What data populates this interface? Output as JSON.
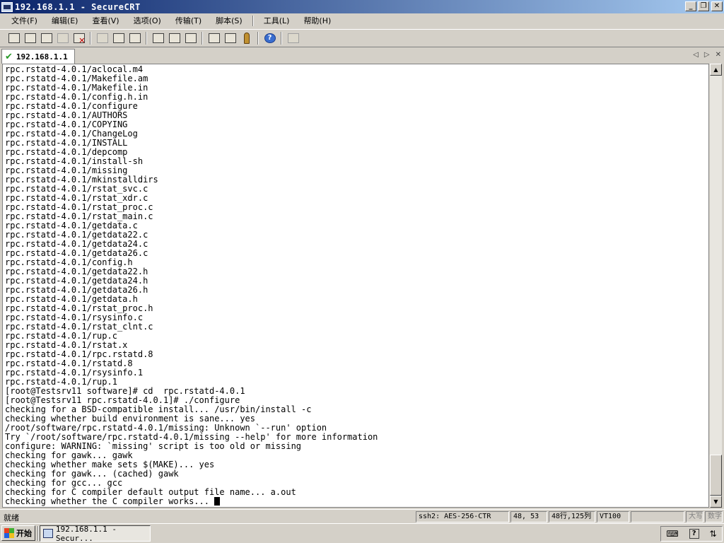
{
  "window": {
    "title": "192.168.1.1 - SecureCRT",
    "buttons": {
      "minimize": "_",
      "maximize": "❐",
      "close": "✕"
    }
  },
  "menu": [
    "文件(F)",
    "编辑(E)",
    "查看(V)",
    "选项(O)",
    "传输(T)",
    "脚本(S)",
    "工具(L)",
    "帮助(H)"
  ],
  "toolbar": {
    "icons": [
      "connect-icon",
      "quick-connect-icon",
      "connect-in-tab-icon",
      "reconnect-icon",
      "disconnect-icon",
      "copy-icon",
      "paste-icon",
      "find-icon",
      "print-icon",
      "print-selection-icon",
      "print-setup-icon",
      "session-options-icon",
      "global-options-icon",
      "keymap-icon",
      "help-icon",
      "sftp-icon"
    ]
  },
  "tab": {
    "label": "192.168.1.1",
    "prev": "◁",
    "next": "▷",
    "close": "✕"
  },
  "terminal": {
    "lines": [
      "rpc.rstatd-4.0.1/aclocal.m4",
      "rpc.rstatd-4.0.1/Makefile.am",
      "rpc.rstatd-4.0.1/Makefile.in",
      "rpc.rstatd-4.0.1/config.h.in",
      "rpc.rstatd-4.0.1/configure",
      "rpc.rstatd-4.0.1/AUTHORS",
      "rpc.rstatd-4.0.1/COPYING",
      "rpc.rstatd-4.0.1/ChangeLog",
      "rpc.rstatd-4.0.1/INSTALL",
      "rpc.rstatd-4.0.1/depcomp",
      "rpc.rstatd-4.0.1/install-sh",
      "rpc.rstatd-4.0.1/missing",
      "rpc.rstatd-4.0.1/mkinstalldirs",
      "rpc.rstatd-4.0.1/rstat_svc.c",
      "rpc.rstatd-4.0.1/rstat_xdr.c",
      "rpc.rstatd-4.0.1/rstat_proc.c",
      "rpc.rstatd-4.0.1/rstat_main.c",
      "rpc.rstatd-4.0.1/getdata.c",
      "rpc.rstatd-4.0.1/getdata22.c",
      "rpc.rstatd-4.0.1/getdata24.c",
      "rpc.rstatd-4.0.1/getdata26.c",
      "rpc.rstatd-4.0.1/config.h",
      "rpc.rstatd-4.0.1/getdata22.h",
      "rpc.rstatd-4.0.1/getdata24.h",
      "rpc.rstatd-4.0.1/getdata26.h",
      "rpc.rstatd-4.0.1/getdata.h",
      "rpc.rstatd-4.0.1/rstat_proc.h",
      "rpc.rstatd-4.0.1/rsysinfo.c",
      "rpc.rstatd-4.0.1/rstat_clnt.c",
      "rpc.rstatd-4.0.1/rup.c",
      "rpc.rstatd-4.0.1/rstat.x",
      "rpc.rstatd-4.0.1/rpc.rstatd.8",
      "rpc.rstatd-4.0.1/rstatd.8",
      "rpc.rstatd-4.0.1/rsysinfo.1",
      "rpc.rstatd-4.0.1/rup.1",
      "[root@Testsrv11 software]# cd  rpc.rstatd-4.0.1",
      "[root@Testsrv11 rpc.rstatd-4.0.1]# ./configure",
      "checking for a BSD-compatible install... /usr/bin/install -c",
      "checking whether build environment is sane... yes",
      "/root/software/rpc.rstatd-4.0.1/missing: Unknown `--run' option",
      "Try `/root/software/rpc.rstatd-4.0.1/missing --help' for more information",
      "configure: WARNING: `missing' script is too old or missing",
      "checking for gawk... gawk",
      "checking whether make sets $(MAKE)... yes",
      "checking for gawk... (cached) gawk",
      "checking for gcc... gcc",
      "checking for C compiler default output file name... a.out",
      "checking whether the C compiler works... "
    ]
  },
  "status": {
    "ready": "就绪",
    "cipher": "ssh2: AES-256-CTR",
    "position": "48,  53",
    "size": "48行,125列",
    "terminal_type": "VT100",
    "caps": "大写",
    "num": "数字"
  },
  "taskbar": {
    "start": "开始",
    "task": "192.168.1.1 - Secur..."
  }
}
